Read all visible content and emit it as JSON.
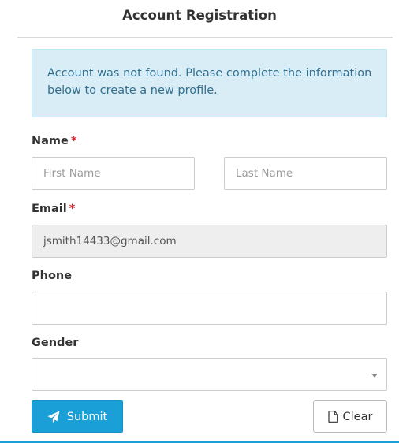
{
  "header": {
    "title": "Account Registration"
  },
  "alert": {
    "message": "Account was not found. Please complete the information below to create a new profile."
  },
  "form": {
    "name": {
      "label": "Name",
      "required_mark": "*",
      "first_placeholder": "First Name",
      "first_value": "",
      "last_placeholder": "Last Name",
      "last_value": ""
    },
    "email": {
      "label": "Email",
      "required_mark": "*",
      "value": "jsmith14433@gmail.com"
    },
    "phone": {
      "label": "Phone",
      "value": ""
    },
    "gender": {
      "label": "Gender",
      "selected": ""
    }
  },
  "actions": {
    "submit_label": "Submit",
    "submit_icon": "paper-plane-icon",
    "clear_label": "Clear",
    "clear_icon": "file-icon"
  },
  "colors": {
    "accent": "#1b9fd7",
    "alert_bg": "#d9edf7",
    "alert_text": "#31708f",
    "required": "#d9262e"
  }
}
